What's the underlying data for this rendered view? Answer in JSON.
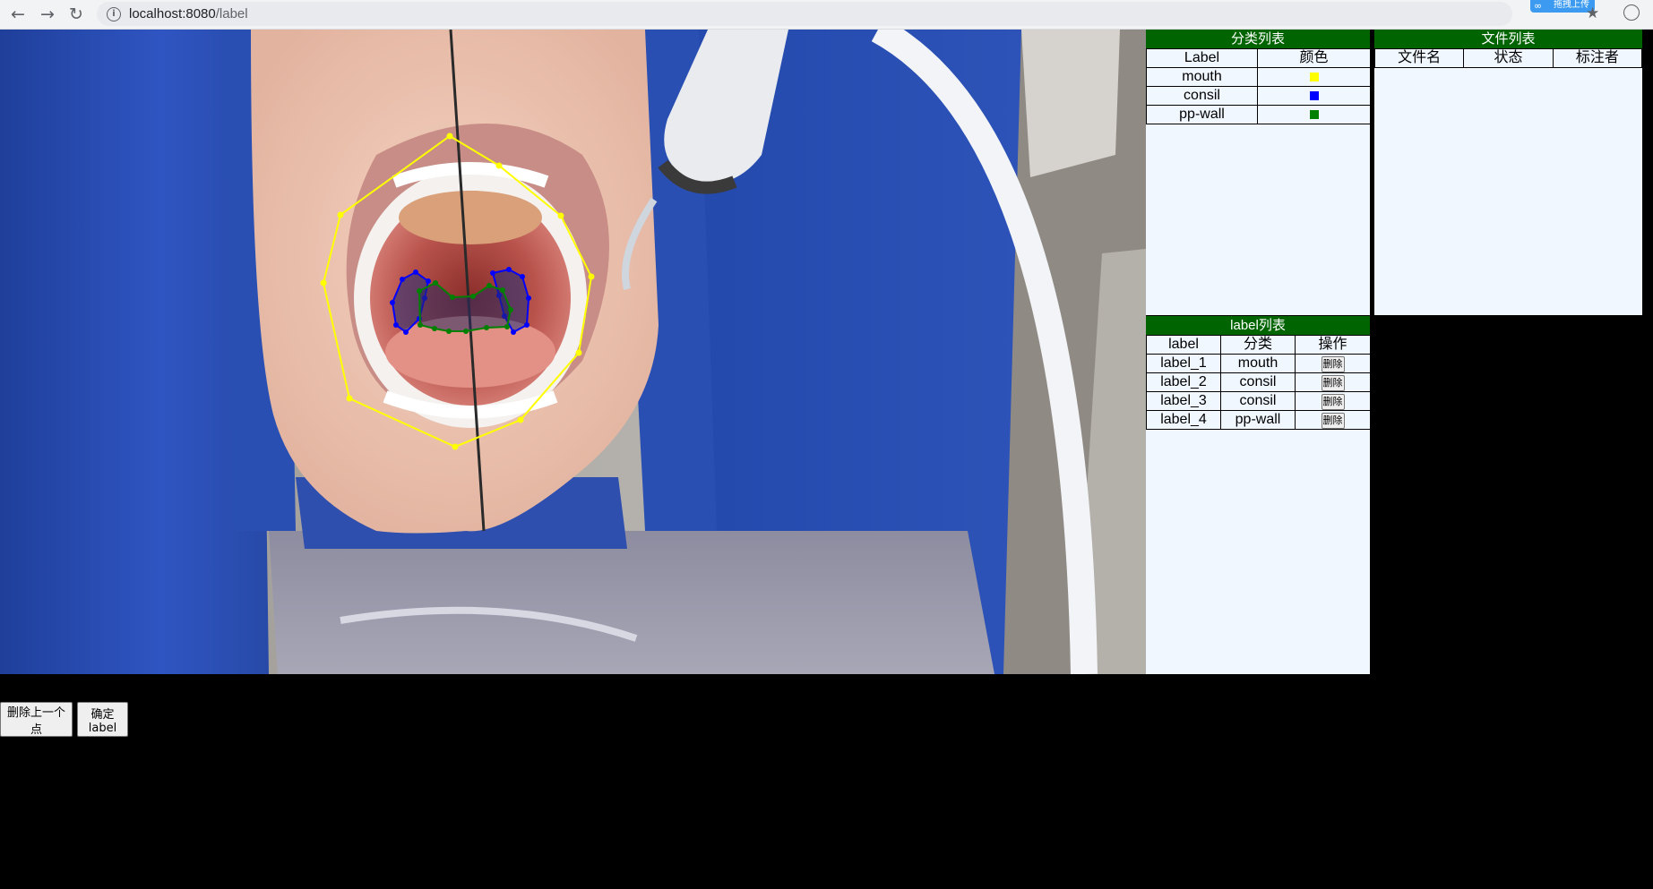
{
  "browser": {
    "url_host": "localhost:8080",
    "url_path": "/label",
    "back_glyph": "←",
    "forward_glyph": "→",
    "reload_glyph": "↻",
    "info_glyph": "i",
    "extension_label": "拖拽上传",
    "extension_glyph": "∞",
    "star_glyph": "★"
  },
  "category_panel": {
    "title": "分类列表",
    "headers": [
      "Label",
      "颜色"
    ],
    "rows": [
      {
        "label": "mouth",
        "color": "#ffff00"
      },
      {
        "label": "consil",
        "color": "#0000ff"
      },
      {
        "label": "pp-wall",
        "color": "#008000"
      }
    ]
  },
  "file_panel": {
    "title": "文件列表",
    "headers": [
      "文件名",
      "状态",
      "标注者"
    ]
  },
  "label_panel": {
    "title": "label列表",
    "headers": [
      "label",
      "分类",
      "操作"
    ],
    "rows": [
      {
        "label": "label_1",
        "category": "mouth",
        "action": "删除"
      },
      {
        "label": "label_2",
        "category": "consil",
        "action": "删除"
      },
      {
        "label": "label_3",
        "category": "consil",
        "action": "删除"
      },
      {
        "label": "label_4",
        "category": "pp-wall",
        "action": "删除"
      }
    ]
  },
  "buttons": {
    "delete_last_point": "删除上一个点",
    "confirm_label": "确定label"
  },
  "colors": {
    "panel_header": "#006400",
    "panel_bg": "#f0f7ff",
    "mouth": "#ffff00",
    "consil": "#0000ff",
    "pp_wall": "#008000"
  }
}
